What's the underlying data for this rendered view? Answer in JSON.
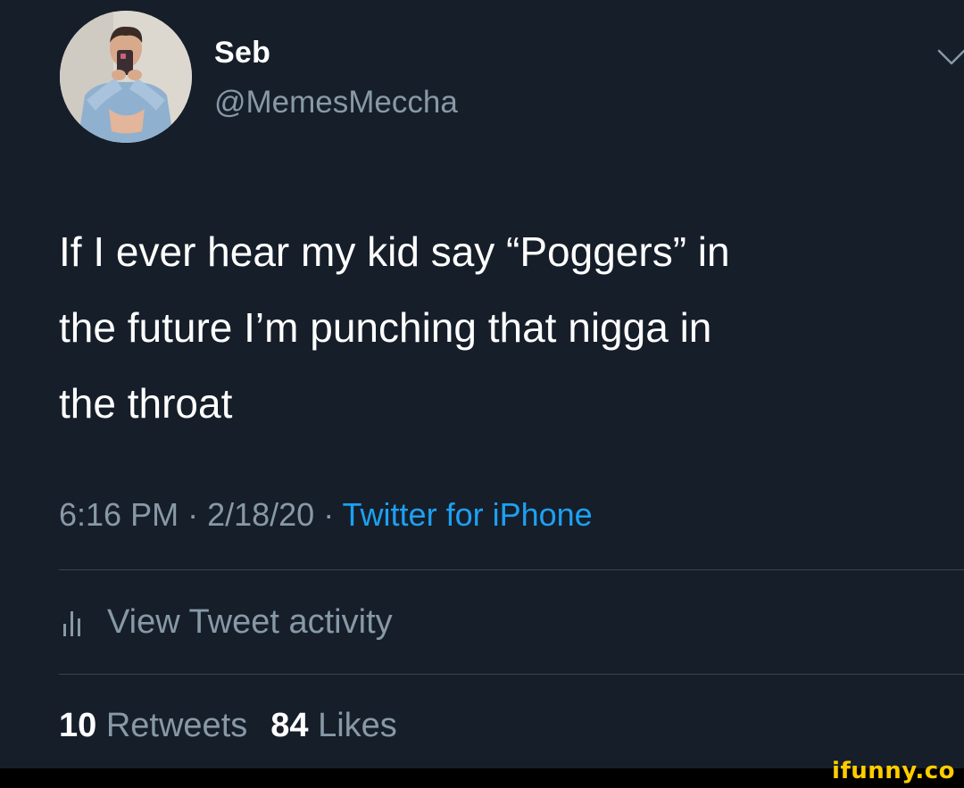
{
  "tweet": {
    "author": {
      "display_name": "Seb",
      "handle": "@MemesMeccha",
      "avatar_icon": "user-avatar-photo"
    },
    "menu_icon": "chevron-down-icon",
    "text": "If I ever hear my kid say “Poggers” in\nthe future I’m punching that nigga in\nthe throat",
    "meta": {
      "time": "6:16 PM",
      "separator": " · ",
      "date": "2/18/20",
      "source": "Twitter for iPhone"
    },
    "activity": {
      "icon": "bar-chart-icon",
      "label": "View Tweet activity"
    },
    "stats": {
      "retweets_count": "10",
      "retweets_label": "Retweets",
      "likes_count": "84",
      "likes_label": "Likes"
    }
  },
  "watermark": {
    "text": "ifunny.co"
  },
  "colors": {
    "background": "#161e2a",
    "secondary_text": "#8899a6",
    "link": "#1da1f2",
    "divider": "#38444d",
    "watermark": "#ffcc00"
  }
}
